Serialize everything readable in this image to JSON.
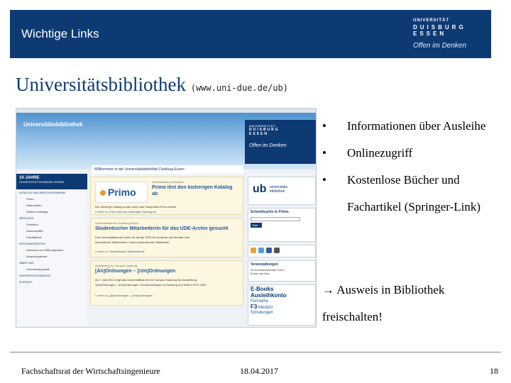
{
  "header": {
    "title": "Wichtige Links",
    "logo_line1": "UNIVERSITÄT",
    "logo_line2": "DUISBURG",
    "logo_line3": "ESSEN",
    "logo_tagline": "Offen im Denken",
    "bar_color": "#0d3a73"
  },
  "slide": {
    "title": "Universitätsbibliothek",
    "url": "(www.uni-due.de/ub)"
  },
  "screenshot": {
    "site_title": "Universitätsbibliothek",
    "logo_line1": "UNIVERSITÄT",
    "logo_line2": "DUISBURG",
    "logo_line3": "ESSEN",
    "logo_tagline": "Offen im Denken",
    "welcome": "Willkommen in der Universitätsbibliothek Duisburg-Essen",
    "side_head_a": "10 JAHRE",
    "side_head_b": "UNIVERSITÄT DUISBURG ESSEN",
    "side_items": [
      {
        "label": "KATALOG UND ABSCHLAGNAHME",
        "sub": false
      },
      {
        "label": "Primo",
        "sub": true
      },
      {
        "label": "Zeitschriften",
        "sub": true
      },
      {
        "label": "Weitere Kataloge",
        "sub": true
      },
      {
        "label": "SERVICES",
        "sub": false
      },
      {
        "label": "Fernleihe",
        "sub": true
      },
      {
        "label": "Dokumentlief.",
        "sub": true
      },
      {
        "label": "Fakultätsrat.",
        "sub": true
      },
      {
        "label": "ÖFFNUNGSZEITEN",
        "sub": false
      },
      {
        "label": "Adressen und Öffnungszeiten",
        "sub": true
      },
      {
        "label": "Ansprechpartner",
        "sub": true
      },
      {
        "label": "ÜBER UNS",
        "sub": false
      },
      {
        "label": "Semesterapparate",
        "sub": true
      },
      {
        "label": "UNIVERSITÄTSARCHIV",
        "sub": false
      },
      {
        "label": "KONTAKT",
        "sub": false
      }
    ],
    "card1": {
      "logo": "Primo",
      "tag": "Vereinfachtes Suchportal",
      "head1": "Primo löst den bisherigen Katalog",
      "head2": "ab",
      "text": "Der bisherige Katalog wurde durch das Suchportal Primo ersetzt",
      "more": "» mehr zu „Primo löst den bisherigen Katalog ab\""
    },
    "card2": {
      "tag": "Universitätsarchiv Duisburg-Essen",
      "head": "Studentischer Mitarbeiter/in für das UDE-Archiv gesucht",
      "text1": "Das Universitätsarchiv sucht ab Januar 2013 für zunächst drei Monate eine",
      "text2": "studentische Mitarbeiterin / einen studentischen Mitarbeiter",
      "more": "» mehr zu „Studentischer Mitarbeiter/in\""
    },
    "card3": {
      "tag": "Ausstellung im Campus Duisburg",
      "head": "[An]Ordnungen – [Um]Ordnungen",
      "text1": "Ab 7. Mai 2012 zeigt das Universitätsarchiv im Campus Duisburg die Ausstellung",
      "text2": "\"[An]Ordnungen – [Um]Ordnungen: Hochschulbauten in Duisburg und Essen 1970-1982\"",
      "more": "» mehr zu „[An]Ordnungen – [Um]Ordnungen\""
    },
    "ub_logo": "ub",
    "ub_text1": "universitäts",
    "ub_text2": "bibliothek",
    "search_title": "Schnellsuche in Primo",
    "start_button": "Start",
    "events_title": "Veranstaltungen",
    "events_line1": "Im Sommersemester 2013",
    "events_line2": "Kurse und Aus-",
    "cloud_words": [
      "E-Books",
      "Ausleihkonto",
      "Fernleihe",
      "F3",
      "Medizin",
      "Schulungen"
    ]
  },
  "bullets": [
    "Informationen über Ausleihe",
    "Onlinezugriff",
    "Kostenlose Bücher und"
  ],
  "bullet_continuation": "Fachartikel (Springer-Link)",
  "note_line1": "→ Ausweis in Bibliothek",
  "note_line2": "freischalten!",
  "footer": {
    "left": "Fachschaftsrat der Wirtschaftsingenieure",
    "date": "18.04.2017",
    "page": "18"
  }
}
